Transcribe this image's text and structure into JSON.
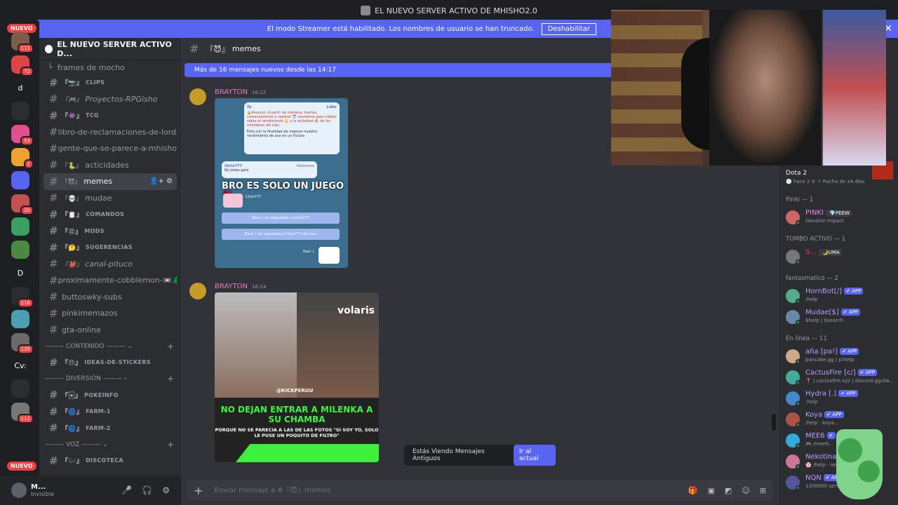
{
  "window": {
    "title": "EL NUEVO SERVER ACTIVO DE MHISHO2.0"
  },
  "banner": {
    "text": "El modo Streamer está habilitado. Los nombres de usuario se han truncado.",
    "button": "Deshabilitar",
    "close": "✕"
  },
  "rail": {
    "nuevo_top": "NUEVO",
    "nuevo_bottom": "NUEVO",
    "servers": [
      {
        "badge": "111",
        "letter": ""
      },
      {
        "badge": "72",
        "letter": ""
      },
      {
        "badge": "",
        "letter": "d"
      },
      {
        "badge": "",
        "letter": ""
      },
      {
        "badge": "53",
        "letter": ""
      },
      {
        "badge": "2",
        "letter": ""
      },
      {
        "badge": "",
        "letter": ""
      },
      {
        "badge": "20",
        "letter": ""
      },
      {
        "badge": "",
        "letter": ""
      },
      {
        "badge": "",
        "letter": ""
      },
      {
        "badge": "",
        "letter": "D"
      },
      {
        "badge": "116",
        "letter": ""
      },
      {
        "badge": "",
        "letter": ""
      },
      {
        "badge": "135",
        "letter": ""
      },
      {
        "badge": "",
        "letter": "Cv:"
      },
      {
        "badge": "",
        "letter": ""
      },
      {
        "badge": "112",
        "letter": ""
      }
    ]
  },
  "sidebar": {
    "server_name": "EL NUEVO SERVER ACTIVO D...",
    "thread": "frames de mocho",
    "channels": [
      {
        "emoji": "『📷』",
        "name": "CLIPS",
        "style": "small"
      },
      {
        "emoji": "『🎮』",
        "name": "Proyectos-RPGisho",
        "style": "ital"
      },
      {
        "emoji": "『👾』",
        "name": "TCG",
        "style": "small"
      },
      {
        "emoji": "",
        "name": "libro-de-reclamaciones-de-lord-...",
        "style": ""
      },
      {
        "emoji": "",
        "name": "gente-que-se-parece-a-mhisho-...",
        "style": ""
      },
      {
        "emoji": "『🐍』",
        "name": "acticidades",
        "style": ""
      },
      {
        "emoji": "『😈』",
        "name": "memes",
        "style": "active"
      },
      {
        "emoji": "『💀』",
        "name": "mudae",
        "style": ""
      },
      {
        "emoji": "『📋』",
        "name": "COMANDOS",
        "style": "small"
      },
      {
        "emoji": "『😡』",
        "name": "MODS",
        "style": "small"
      },
      {
        "emoji": "『🤔』",
        "name": "SUGERENCIAS",
        "style": "small"
      },
      {
        "emoji": "『👹』",
        "name": "canal-pituco",
        "style": "ital"
      },
      {
        "emoji": "",
        "name": "proximamente-cobblemon-📼🌲...",
        "style": ""
      },
      {
        "emoji": "",
        "name": "buttoswky-subs",
        "style": ""
      },
      {
        "emoji": "",
        "name": "pinkimemazos",
        "style": ""
      },
      {
        "emoji": "",
        "name": "gta-online",
        "style": ""
      }
    ],
    "cat_contenido": "CONTENIDO",
    "contenido_channels": [
      {
        "emoji": "『😣』",
        "name": "IDEAS-DE-STICKERS"
      }
    ],
    "cat_diversion": "DIVERSIÓN",
    "diversion_channels": [
      {
        "emoji": "『🃏』",
        "name": "POKEINFO"
      },
      {
        "emoji": "『🌀』",
        "name": "FARM-1"
      },
      {
        "emoji": "『🌀』",
        "name": "FARM-2"
      }
    ],
    "cat_voz": "VOZ",
    "voz_channels": [
      {
        "emoji": "『🎶』",
        "name": "DISCOTECA"
      }
    ]
  },
  "user": {
    "name": "M...",
    "status": "Invisible"
  },
  "chat": {
    "channel_emoji": "『😈』",
    "channel_name": "memes",
    "new_messages": "Más de 16 mensajes nuevos desde las 14:17",
    "messages": [
      {
        "author": "BRAYTON",
        "time": "16:12"
      },
      {
        "author": "BRAYTON",
        "time": "16:24"
      }
    ],
    "meme1": {
      "bubble_author": "Tú",
      "bubble_role": "Líder",
      "announcement": "🔒Anuncio: A partir de mañana, martes, comenzaremos a realizar 🗓️ reuniones para hablar sobre el rendimiento 💪 y la actividad 🔥 de los miembros del clan.",
      "announcement2": "Esto con la finalidad de mejorar nuestro rendimiento de ace en un Futuro",
      "reply_author": "Chris777",
      "reply_role": "Veterano",
      "reply_text": "No jodas gato",
      "overlay": "BRO ES SOLO UN JUEGO 🌹",
      "sticker_user": "Chris777",
      "event1": "Raul ↓ ha degradado a Chris777",
      "event2": "Raul ↓ ha expulsado a Chris777 del clan",
      "footer_user": "Raul ↓"
    },
    "meme2": {
      "brand": "volaris",
      "handle": "@KICKPERUU",
      "headline": "NO DEJAN ENTRAR A MILENKA A SU CHAMBA",
      "caption": "PORQUE NO SE PARECIA A LAS DE LAS FOTOS \"SI SOY YO, SOLO LE PUSE UN POQUITO DE FILTRO\""
    },
    "toast_text": "Estás Viendo Mensajes Antiguos",
    "toast_button": "Ir al actual",
    "composer_placeholder": "Enviar mensaje a #『😈』memes"
  },
  "members": {
    "activity_game": "Dota 2",
    "activity_time": "hace 2 d",
    "activity_streak": "Racha de x4 días",
    "groups": [
      {
        "title": "Pinki — 1",
        "people": [
          {
            "name": "PINKI",
            "tag": "💎PEEW",
            "act": "Genshin Impact",
            "color": "#f47fff",
            "app": ""
          }
        ]
      },
      {
        "title": "TOMBO ACTIVO — 1",
        "people": [
          {
            "name": "S...",
            "tag": "🌙UMA",
            "act": "",
            "color": "#f23f43",
            "app": ""
          }
        ]
      },
      {
        "title": "fantasmatico — 2",
        "people": [
          {
            "name": "HornBot[/]",
            "tag": "",
            "act": "/help",
            "color": "#b5a0ff",
            "app": "✔ APP"
          },
          {
            "name": "Mudae[$]",
            "tag": "",
            "act": "$help | $search",
            "color": "#b5a0ff",
            "app": "✔ APP"
          }
        ]
      },
      {
        "title": "En línea — 11",
        "people": [
          {
            "name": "aña [pa!]",
            "tag": "",
            "act": "pancake.gg | p!help",
            "color": "#b5a0ff",
            "app": "✔ APP"
          },
          {
            "name": "CactusFire [c/]",
            "tag": "",
            "act": "📍 | cactusfire.xyz | discord.gg/dw...",
            "color": "#b5a0ff",
            "app": "✔ APP"
          },
          {
            "name": "Hydra [.]",
            "tag": "",
            "act": ".help",
            "color": "#b5a0ff",
            "app": "✔ APP"
          },
          {
            "name": "Koya",
            "tag": "",
            "act": "/help · koya...",
            "color": "#b5a0ff",
            "app": "✔ APP"
          },
          {
            "name": "MEE6",
            "tag": "",
            "act": "🎮 /mee6...",
            "color": "#b5a0ff",
            "app": "✔"
          },
          {
            "name": "Nekotina",
            "tag": "",
            "act": "🌸 /help · ne...",
            "color": "#b5a0ff",
            "app": ""
          },
          {
            "name": "NQN",
            "tag": "",
            "act": "1200000 servers...",
            "color": "#b5a0ff",
            "app": "✔ AP"
          }
        ]
      }
    ]
  }
}
